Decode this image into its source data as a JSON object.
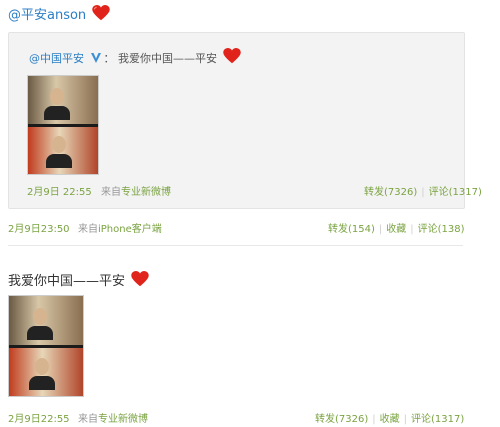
{
  "post": {
    "author": "@平安anson",
    "quoted": {
      "user": "@中国平安",
      "text": "我爱你中国——平安",
      "time": "2月9日 22:55",
      "source_prefix": "来自",
      "source": "专业新微博",
      "repost": "转发(7326)",
      "comment": "评论(1317)"
    },
    "time": "2月9日23:50",
    "source_prefix": "来自",
    "source": "iPhone客户端",
    "repost": "转发(154)",
    "favorite": "收藏",
    "comment": "评论(138)"
  },
  "second": {
    "text": "我爱你中国——平安",
    "time": "2月9日22:55",
    "source_prefix": "来自",
    "source": "专业新微博",
    "repost": "转发(7326)",
    "favorite": "收藏",
    "comment": "评论(1317)"
  },
  "icons": {
    "heart": "heart-icon",
    "verified": "verified-v-icon"
  },
  "colors": {
    "link_blue": "#2b7ec4",
    "meta_green": "#7aa341",
    "heart_red": "#e0241b"
  }
}
